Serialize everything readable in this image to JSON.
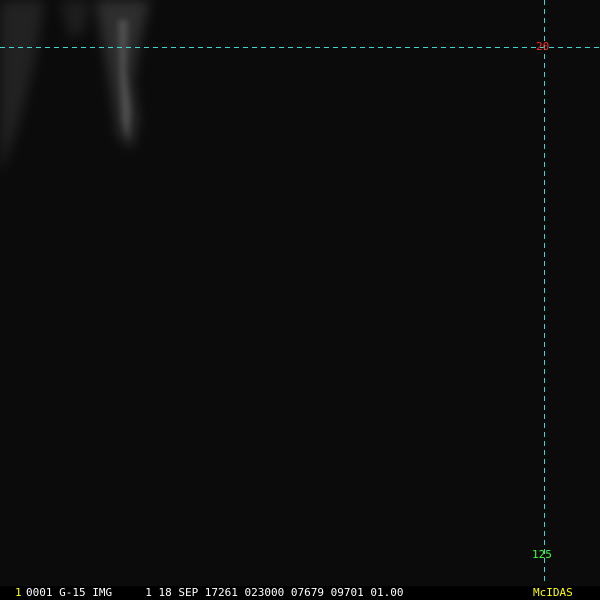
{
  "image": {
    "background_color": "#0b0b0b",
    "cloud_color": "#8a8a8a",
    "grid_color": "#3fd6d6"
  },
  "grid": {
    "latitude_label": "20",
    "latitude_label_color": "#ff2a2a",
    "longitude_label": "125",
    "longitude_label_color": "#3cff3c"
  },
  "status_bar": {
    "frame_number": "1",
    "frame_number_color": "#ffff00",
    "text": "0001 G-15 IMG     1 18 SEP 17261 023000 07679 09701 01.00",
    "text_color": "#ffffff",
    "product": "McIDAS",
    "product_color": "#ffff00"
  }
}
